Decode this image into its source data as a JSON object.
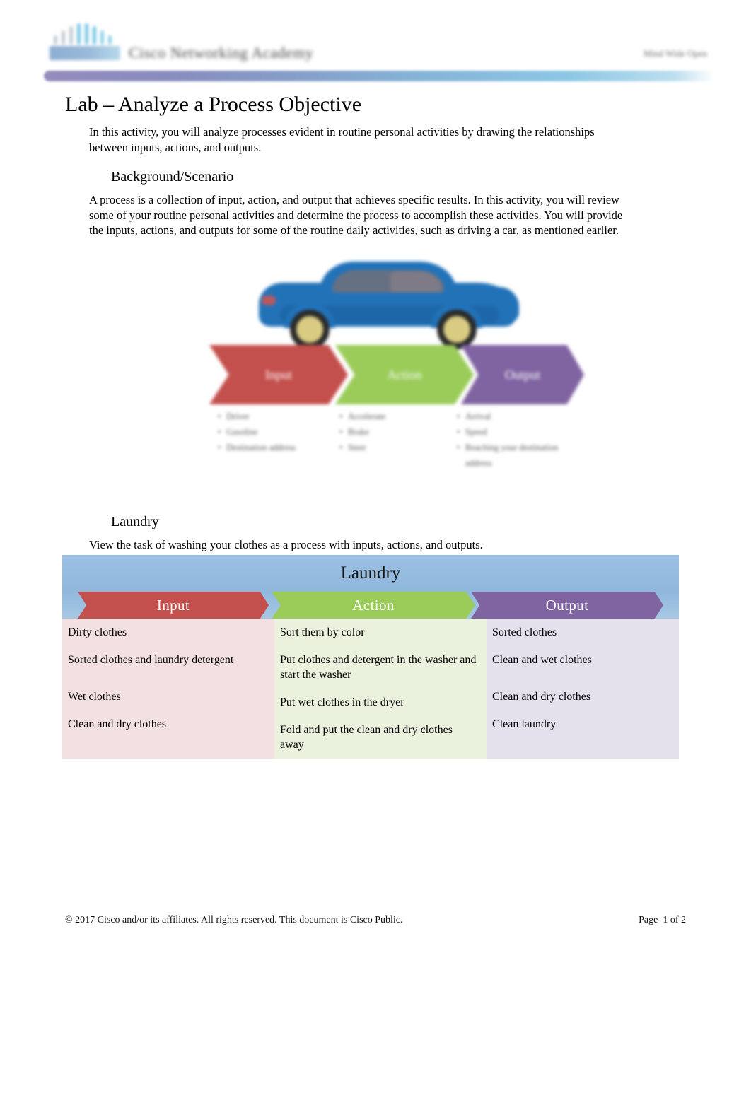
{
  "header": {
    "logo_alt": "cisco-logo",
    "academy_name": "Cisco Networking Academy",
    "right_label": "Mind Wide Open"
  },
  "document": {
    "title": "Lab – Analyze a Process Objective",
    "intro": "In this activity, you will analyze processes evident in routine personal activities by drawing the relationships between inputs, actions, and outputs.",
    "background_heading": "Background/Scenario",
    "background_text": "A process is a collection of input, action, and output that achieves specific results. In this activity, you will review some of your routine personal activities and determine the process to accomplish these activities. You will provide the inputs, actions, and outputs for some of the routine daily activities, such as driving a car, as mentioned earlier.",
    "laundry_heading": "Laundry",
    "laundry_text": "View the task of washing your clothes as a process with inputs, actions, and outputs."
  },
  "figure": {
    "alt": "car-process-diagram",
    "chevrons": [
      {
        "label": "Input",
        "color": "#c4504d"
      },
      {
        "label": "Action",
        "color": "#9bcc5a"
      },
      {
        "label": "Output",
        "color": "#8064a2"
      }
    ],
    "lists": [
      {
        "items": [
          "Driver",
          "Gasoline",
          "Destination address"
        ]
      },
      {
        "items": [
          "Accelerate",
          "Brake",
          "Steer"
        ]
      },
      {
        "items": [
          "Arrival",
          "Speed",
          "Reaching your destination address"
        ]
      }
    ]
  },
  "table": {
    "title": "Laundry",
    "columns": [
      {
        "key": "input",
        "label": "Input",
        "color": "#c4504d",
        "bg": "#f3e1e1"
      },
      {
        "key": "action",
        "label": "Action",
        "color": "#9bcc5a",
        "bg": "#eaf2de"
      },
      {
        "key": "output",
        "label": "Output",
        "color": "#8064a2",
        "bg": "#e4e1ec"
      }
    ],
    "rows": [
      {
        "input": "Dirty clothes",
        "action": "Sort them by color",
        "output": "Sorted clothes"
      },
      {
        "input": "Sorted clothes and laundry detergent",
        "action": "Put clothes and detergent in the washer and start the washer",
        "output": "Clean and wet clothes"
      },
      {
        "input": "Wet clothes",
        "action": "Put wet clothes in the dryer",
        "output": "Clean and dry clothes"
      },
      {
        "input": "Clean and dry clothes",
        "action": "Fold and put the clean and dry clothes away",
        "output": "Clean laundry"
      }
    ]
  },
  "footer": {
    "copyright": "© 2017 Cisco and/or its affiliates. All rights reserved. This document is Cisco Public.",
    "page": "Page  1 of 2"
  },
  "colors": {
    "input_red": "#c4504d",
    "action_green": "#9bcc5a",
    "output_purple": "#8064a2",
    "table_header_blue": "#9cc0e2",
    "rule_purple": "#8f86b9",
    "rule_blue": "#86c4e2"
  }
}
